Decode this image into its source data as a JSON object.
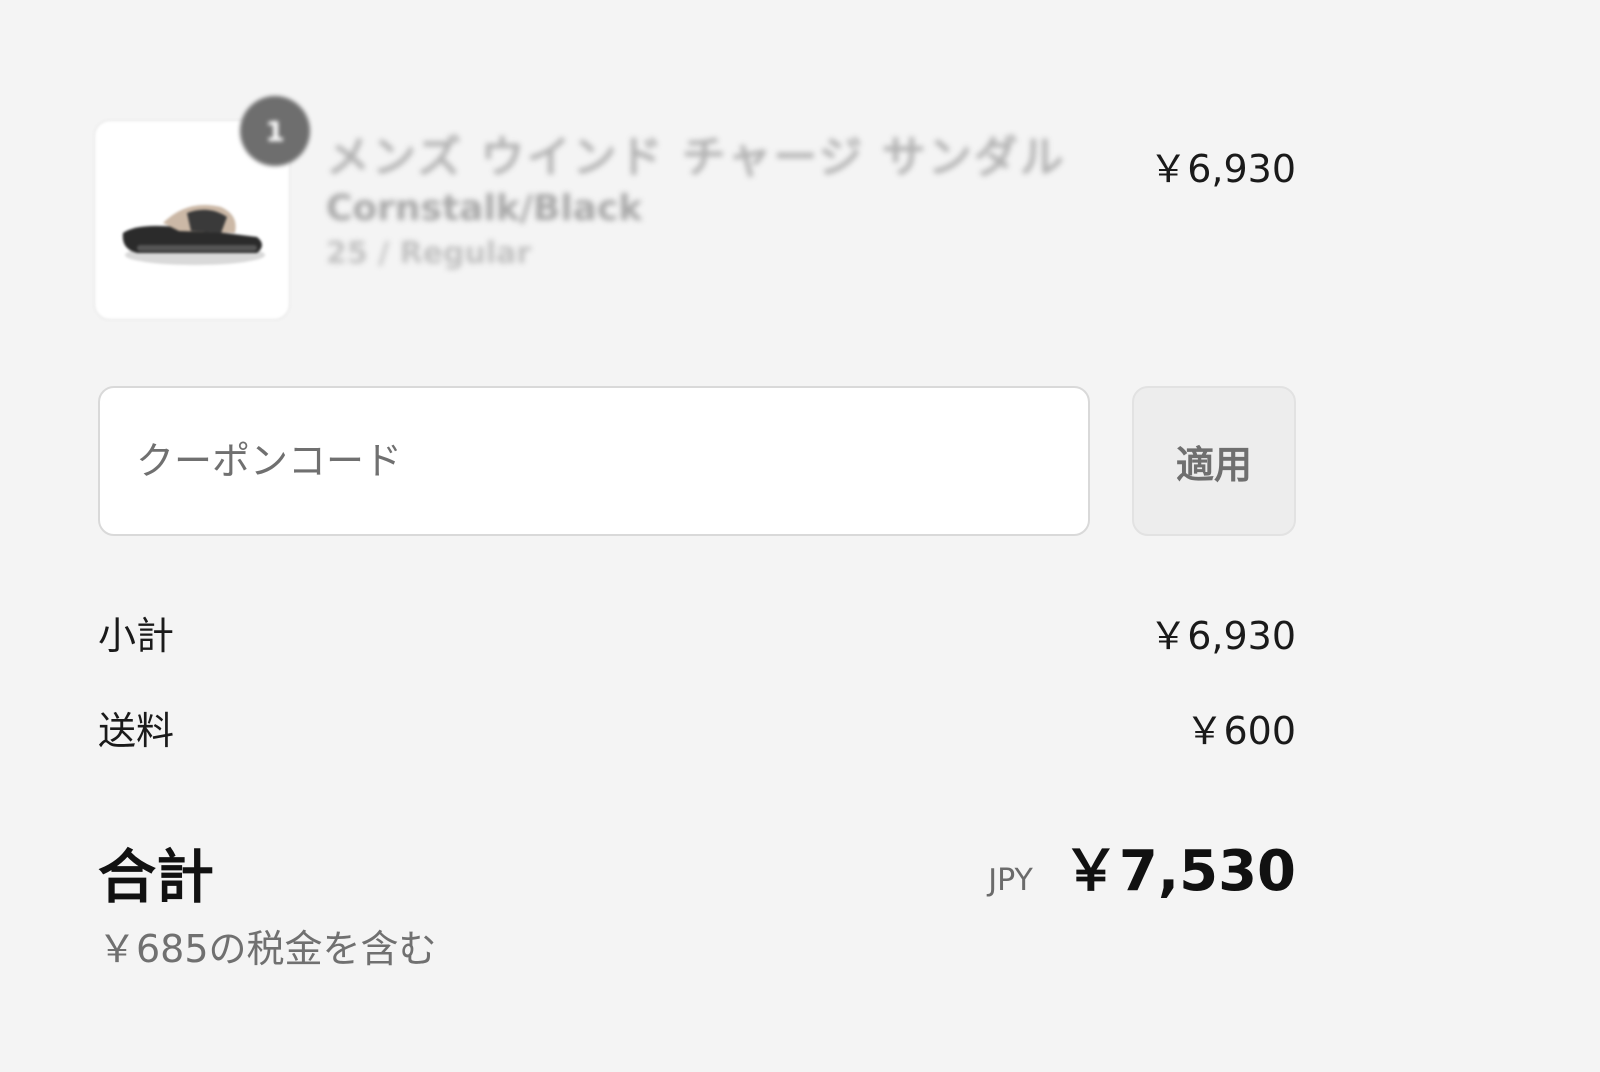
{
  "line_item": {
    "quantity": "1",
    "name": "メンズ ウインド チャージ サンダル",
    "variant": "Cornstalk/Black",
    "size": "25 / Regular",
    "price": "￥6,930"
  },
  "coupon": {
    "placeholder": "クーポンコード",
    "value": "",
    "apply_label": "適用"
  },
  "summary": {
    "subtotal_label": "小計",
    "subtotal_value": "￥6,930",
    "shipping_label": "送料",
    "shipping_value": "￥600"
  },
  "total": {
    "label": "合計",
    "currency": "JPY",
    "amount": "￥7,530",
    "tax_note": "￥685の税金を含む"
  },
  "colors": {
    "background": "#f4f4f4",
    "badge": "#6e6e6e",
    "button_bg": "#ededed",
    "text_primary": "#1a1a1a",
    "text_muted": "#707070"
  }
}
